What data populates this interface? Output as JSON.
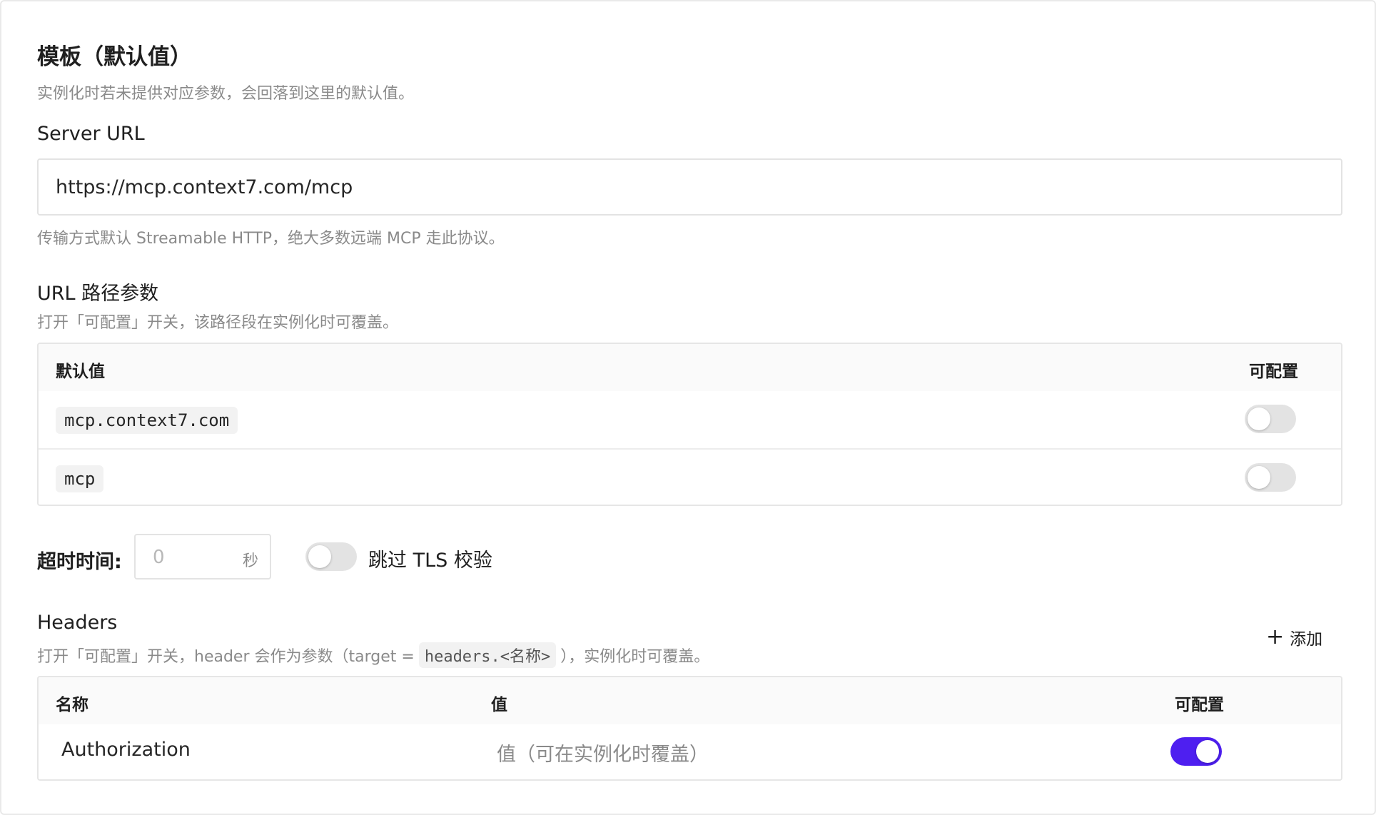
{
  "template": {
    "title": "模板（默认值）",
    "description": "实例化时若未提供对应参数，会回落到这里的默认值。"
  },
  "server_url": {
    "label": "Server URL",
    "value": "https://mcp.context7.com/mcp",
    "hint": "传输方式默认 Streamable HTTP，绝大多数远端 MCP 走此协议。"
  },
  "path_params": {
    "label": "URL 路径参数",
    "description": "打开「可配置」开关，该路径段在实例化时可覆盖。",
    "columns": {
      "default": "默认值",
      "configurable": "可配置"
    },
    "rows": [
      {
        "value": "mcp.context7.com",
        "configurable": false
      },
      {
        "value": "mcp",
        "configurable": false
      }
    ]
  },
  "timeout": {
    "label": "超时时间:",
    "value": "0",
    "unit": "秒"
  },
  "tls": {
    "label": "跳过 TLS 校验",
    "enabled": false
  },
  "headers": {
    "label": "Headers",
    "description_prefix": "打开「可配置」开关，header 会作为参数（target =",
    "description_code": "headers.<名称>",
    "description_suffix": "），实例化时可覆盖。",
    "add_label": "添加",
    "columns": {
      "name": "名称",
      "value": "值",
      "configurable": "可配置"
    },
    "rows": [
      {
        "name": "Authorization",
        "value_placeholder": "值（可在实例化时覆盖）",
        "configurable": true
      }
    ]
  },
  "colors": {
    "accent": "#4e1ff0",
    "toggle_off": "#e3e3e3",
    "muted_text": "#8a8a8a"
  }
}
